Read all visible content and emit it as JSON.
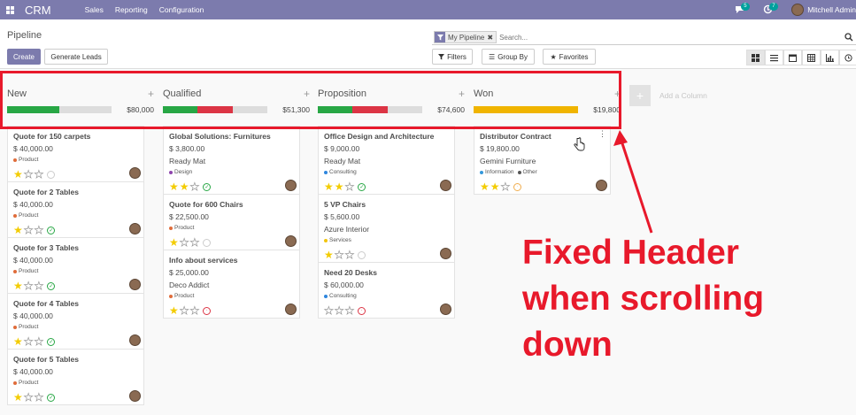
{
  "navbar": {
    "brand": "CRM",
    "menu": [
      "Sales",
      "Reporting",
      "Configuration"
    ],
    "chat_count": "5",
    "activity_count": "7",
    "user": "Mitchell Admin"
  },
  "control": {
    "title": "Pipeline",
    "create_label": "Create",
    "generate_label": "Generate Leads",
    "facet": "My Pipeline",
    "search_placeholder": "Search...",
    "filters_label": "Filters",
    "groupby_label": "Group By",
    "favorites_label": "Favorites"
  },
  "columns": [
    {
      "title": "New",
      "sum": "$80,000",
      "cards": [
        {
          "title": "Quote for 150 carpets",
          "amount": "$ 40,000.00",
          "tags": [
            {
              "label": "Product",
              "color": "#e06c3a"
            }
          ],
          "stars": 1,
          "activity": "none"
        },
        {
          "title": "Quote for 2 Tables",
          "amount": "$ 40,000.00",
          "tags": [
            {
              "label": "Product",
              "color": "#e06c3a"
            }
          ],
          "stars": 1,
          "activity": "ok"
        },
        {
          "title": "Quote for 3 Tables",
          "amount": "$ 40,000.00",
          "tags": [
            {
              "label": "Product",
              "color": "#e06c3a"
            }
          ],
          "stars": 1,
          "activity": "ok"
        },
        {
          "title": "Quote for 4 Tables",
          "amount": "$ 40,000.00",
          "tags": [
            {
              "label": "Product",
              "color": "#e06c3a"
            }
          ],
          "stars": 1,
          "activity": "ok"
        },
        {
          "title": "Quote for 5 Tables",
          "amount": "$ 40,000.00",
          "tags": [
            {
              "label": "Product",
              "color": "#e06c3a"
            }
          ],
          "stars": 1,
          "activity": "ok"
        }
      ]
    },
    {
      "title": "Qualified",
      "sum": "$51,300",
      "cards": [
        {
          "title": "Global Solutions: Furnitures",
          "amount": "$ 3,800.00",
          "company": "Ready Mat",
          "tags": [
            {
              "label": "Design",
              "color": "#8e44ad"
            }
          ],
          "stars": 2,
          "activity": "ok"
        },
        {
          "title": "Quote for 600 Chairs",
          "amount": "$ 22,500.00",
          "tags": [
            {
              "label": "Product",
              "color": "#e06c3a"
            }
          ],
          "stars": 1,
          "activity": "none"
        },
        {
          "title": "Info about services",
          "amount": "$ 25,000.00",
          "company": "Deco Addict",
          "tags": [
            {
              "label": "Product",
              "color": "#e06c3a"
            }
          ],
          "stars": 1,
          "activity": "late"
        }
      ]
    },
    {
      "title": "Proposition",
      "sum": "$74,600",
      "cards": [
        {
          "title": "Office Design and Architecture",
          "amount": "$ 9,000.00",
          "company": "Ready Mat",
          "tags": [
            {
              "label": "Consulting",
              "color": "#2e86de"
            }
          ],
          "stars": 2,
          "activity": "ok"
        },
        {
          "title": "5 VP Chairs",
          "amount": "$ 5,600.00",
          "company": "Azure Interior",
          "tags": [
            {
              "label": "Services",
              "color": "#f1c40f"
            }
          ],
          "stars": 1,
          "activity": "none"
        },
        {
          "title": "Need 20 Desks",
          "amount": "$ 60,000.00",
          "tags": [
            {
              "label": "Consulting",
              "color": "#2e86de"
            }
          ],
          "stars": 0,
          "activity": "late"
        }
      ]
    },
    {
      "title": "Won",
      "sum": "$19,800",
      "cards": [
        {
          "title": "Distributor Contract",
          "amount": "$ 19,800.00",
          "company": "Gemini Furniture",
          "tags": [
            {
              "label": "Information",
              "color": "#3498db"
            },
            {
              "label": "Other",
              "color": "#555555"
            }
          ],
          "stars": 2,
          "activity": "warn"
        }
      ]
    }
  ],
  "progress": [
    [
      {
        "pct": 50,
        "color": "#28a745"
      }
    ],
    [
      {
        "pct": 33,
        "color": "#28a745"
      },
      {
        "pct": 34,
        "color": "#dc3545"
      }
    ],
    [
      {
        "pct": 33,
        "color": "#28a745"
      },
      {
        "pct": 34,
        "color": "#dc3545"
      }
    ],
    [
      {
        "pct": 100,
        "color": "#f0b400"
      }
    ]
  ],
  "add_column_label": "Add a Column",
  "annotation": {
    "lines": [
      "Fixed Header",
      "when scrolling",
      "down"
    ],
    "color": "#e8192b"
  }
}
